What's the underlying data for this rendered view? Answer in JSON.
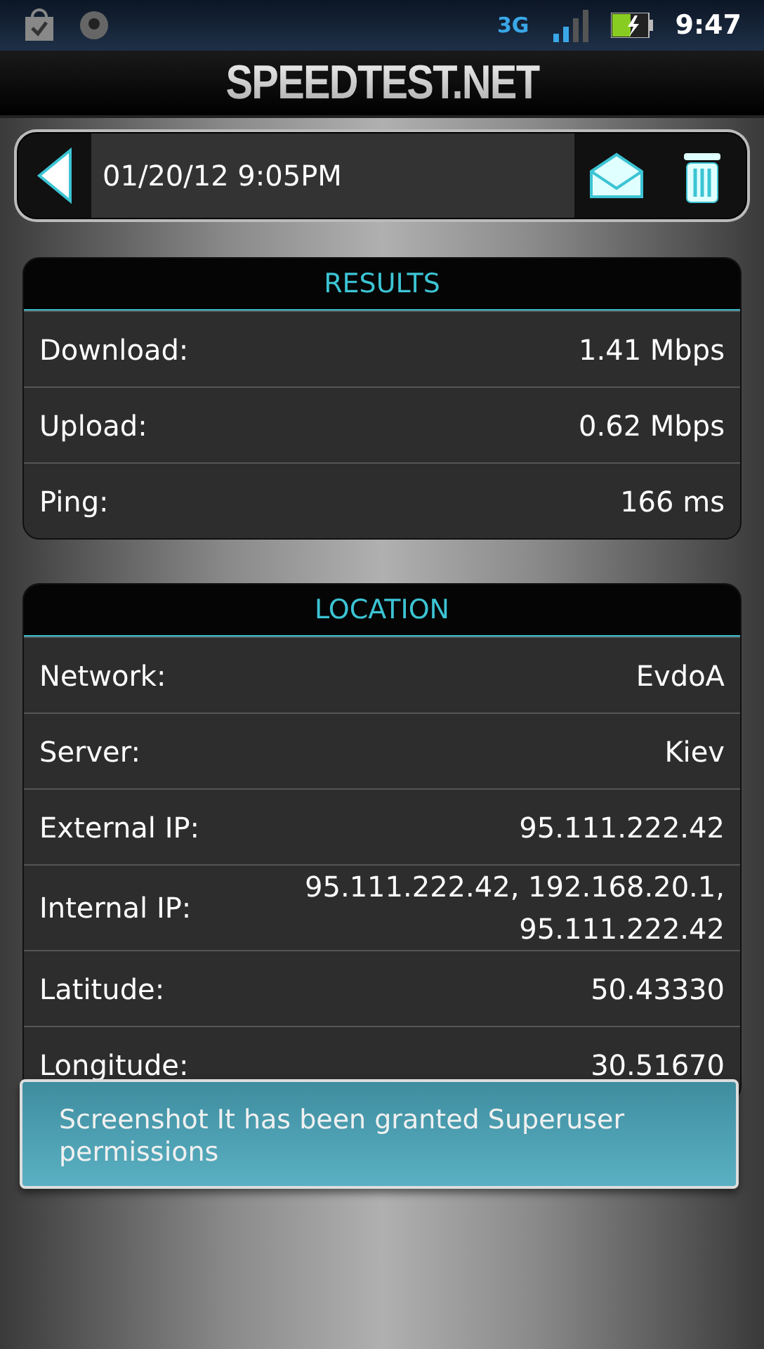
{
  "status_bar": {
    "network": "3G",
    "time": "9:47"
  },
  "header": {
    "title": "SPEEDTEST.NET"
  },
  "toolbar": {
    "date": "01/20/12 9:05PM"
  },
  "sections": [
    {
      "title": "RESULTS",
      "rows": [
        {
          "label": "Download:",
          "value": "1.41 Mbps"
        },
        {
          "label": "Upload:",
          "value": "0.62 Mbps"
        },
        {
          "label": "Ping:",
          "value": "166 ms"
        }
      ]
    },
    {
      "title": "LOCATION",
      "rows": [
        {
          "label": "Network:",
          "value": "EvdoA"
        },
        {
          "label": "Server:",
          "value": "Kiev"
        },
        {
          "label": "External IP:",
          "value": "95.111.222.42"
        },
        {
          "label": "Internal IP:",
          "value": "95.111.222.42, 192.168.20.1, 95.111.222.42"
        },
        {
          "label": "Latitude:",
          "value": "50.43330"
        },
        {
          "label": "Longitude:",
          "value": "30.51670"
        }
      ]
    }
  ],
  "toast": {
    "text": "Screenshot It has been granted Superuser permissions"
  }
}
